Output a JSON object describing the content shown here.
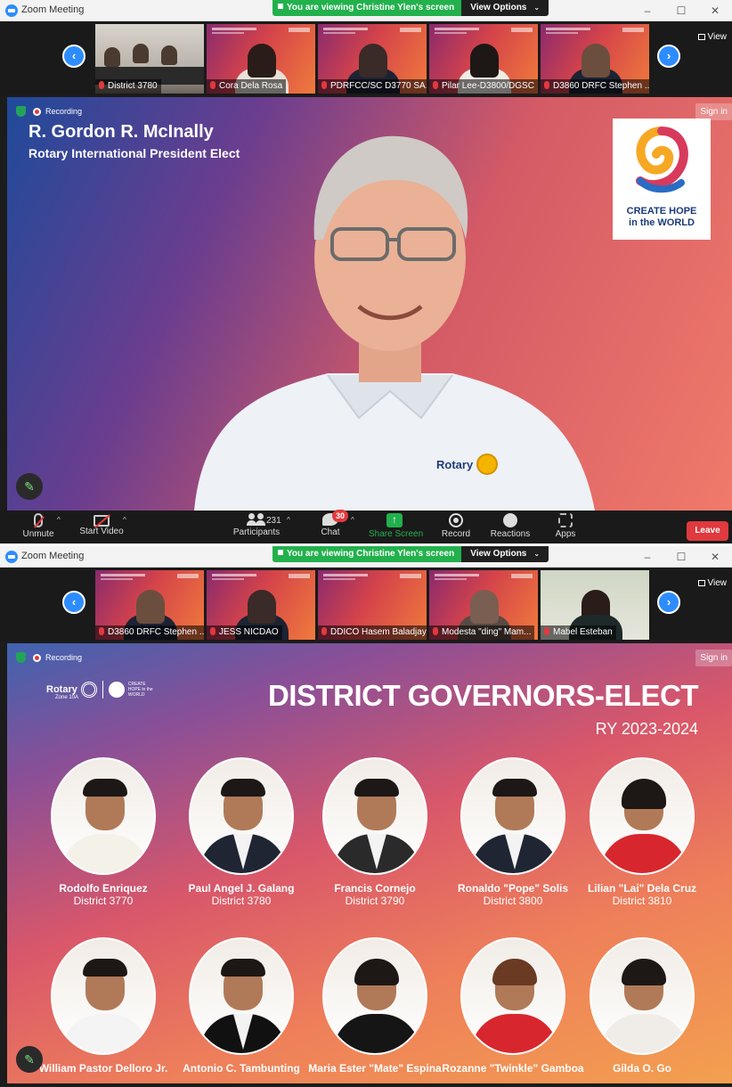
{
  "windows": [
    {
      "title": "Zoom Meeting",
      "share_banner": "You are viewing Christine Ylen's screen",
      "view_options": "View Options",
      "controls": [
        "–",
        "☐",
        "✕"
      ],
      "view_label": "View",
      "thumbnails": [
        "District 3780",
        "Cora Dela Rosa",
        "PDRFCC/SC D3770 SA...",
        "Pilar Lee-D3800/DGSC",
        "D3860 DRFC Stephen ..."
      ],
      "recording_label": "Recording",
      "signin_label": "Sign in",
      "slide": {
        "speaker_name": "R. Gordon R. McInally",
        "speaker_title": "Rotary International President Elect",
        "hope_line1": "CREATE HOPE",
        "hope_line2": "in the WORLD",
        "shirt_text": "Rotary"
      },
      "toolbar": {
        "unmute": "Unmute",
        "start_video": "Start Video",
        "participants": "Participants",
        "participant_count": "231",
        "chat": "Chat",
        "chat_badge": "30",
        "share_screen": "Share Screen",
        "record": "Record",
        "reactions": "Reactions",
        "apps": "Apps",
        "leave": "Leave"
      }
    },
    {
      "title": "Zoom Meeting",
      "share_banner": "You are viewing Christine Ylen's screen",
      "view_options": "View Options",
      "controls": [
        "–",
        "☐",
        "✕"
      ],
      "view_label": "View",
      "thumbnails": [
        "D3860 DRFC Stephen ...",
        "JESS NICDAO",
        "DDICO Hasem Baladjay",
        "Modesta \"ding\" Mam...",
        "Mabel Esteban"
      ],
      "recording_label": "Recording",
      "signin_label": "Sign in",
      "slide": {
        "logo_rotary": "Rotary",
        "logo_zone": "Zone 10A",
        "logo_hope": "CREATE HOPE in the WORLD",
        "title": "DISTRICT GOVERNORS-ELECT",
        "subtitle": "RY 2023-2024",
        "candidates_row1": [
          {
            "name": "Rodolfo Enriquez",
            "district": "District 3770"
          },
          {
            "name": "Paul Angel J. Galang",
            "district": "District 3780"
          },
          {
            "name": "Francis Cornejo",
            "district": "District 3790"
          },
          {
            "name": "Ronaldo \"Pope\" Solis",
            "district": "District 3800"
          },
          {
            "name": "Lilian \"Lai\" Dela Cruz",
            "district": "District 3810"
          }
        ],
        "candidates_row2": [
          {
            "name": "William Pastor Delloro Jr."
          },
          {
            "name": "Antonio C. Tambunting"
          },
          {
            "name": "Maria Ester \"Mate\" Espina"
          },
          {
            "name": "Rozanne \"Twinkle\" Gamboa"
          },
          {
            "name": "Gilda O. Go"
          }
        ]
      }
    }
  ],
  "colors": {
    "zoom_blue": "#2d8cff",
    "share_green": "#22b14c",
    "leave_red": "#e0393e",
    "toolbar_bg": "#1a1a1a"
  },
  "icons": [
    "zoom-logo-icon",
    "speaker-icon",
    "chevron-down-icon",
    "minimize-icon",
    "maximize-icon",
    "close-icon",
    "chevron-left-icon",
    "chevron-right-icon",
    "grid-view-icon",
    "muted-mic-icon",
    "shield-icon",
    "record-dot-icon",
    "pencil-icon",
    "video-off-icon",
    "participants-icon",
    "chat-icon",
    "share-screen-icon",
    "record-icon",
    "reactions-icon",
    "apps-icon"
  ]
}
